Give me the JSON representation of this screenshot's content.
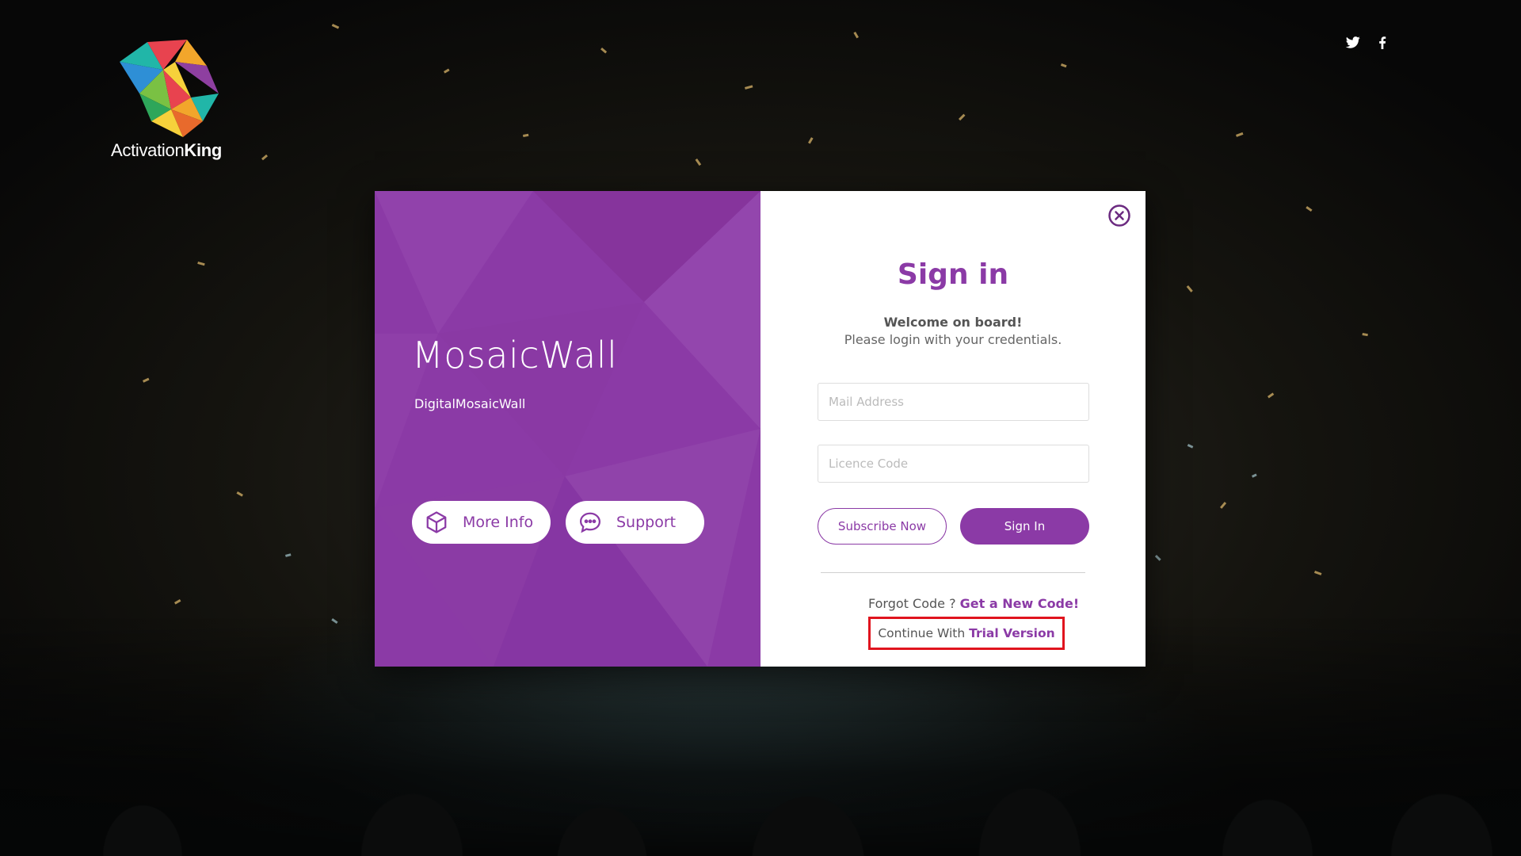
{
  "brand": {
    "logo_text_light": "Activation",
    "logo_text_bold": "King"
  },
  "social": {
    "twitter_icon": "twitter-icon",
    "facebook_icon": "facebook-icon"
  },
  "left_panel": {
    "title": "MosaicWall",
    "subtitle": "DigitalMosaicWall",
    "more_info_label": "More Info",
    "support_label": "Support",
    "accent_color": "#8b3aa6"
  },
  "signin": {
    "title": "Sign in",
    "welcome": "Welcome on board!",
    "instructions": "Please login with your credentials.",
    "mail_placeholder": "Mail Address",
    "mail_value": "",
    "code_placeholder": "Licence Code",
    "code_value": "",
    "subscribe_label": "Subscribe Now",
    "signin_label": "Sign In",
    "forgot_text": "Forgot Code ? ",
    "forgot_link": "Get a New Code!",
    "trial_text": "Continue With ",
    "trial_link": "Trial Version",
    "highlight_color": "#e0141e"
  }
}
